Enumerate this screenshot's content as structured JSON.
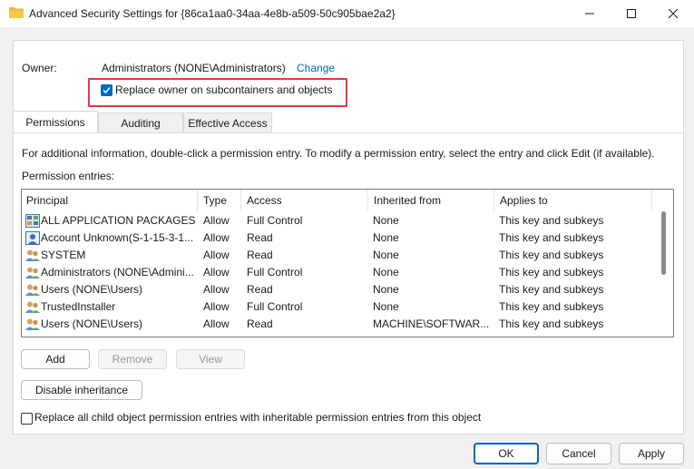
{
  "window": {
    "title": "Advanced Security Settings for {86ca1aa0-34aa-4e8b-a509-50c905bae2a2}"
  },
  "owner": {
    "label": "Owner:",
    "value": "Administrators (NONE\\Administrators)",
    "change_link": "Change",
    "replace_checkbox_label": "Replace owner on subcontainers and objects",
    "replace_checked": true
  },
  "tabs": [
    {
      "label": "Permissions",
      "active": true
    },
    {
      "label": "Auditing",
      "active": false
    },
    {
      "label": "Effective Access",
      "active": false
    }
  ],
  "permissions": {
    "info": "For additional information, double-click a permission entry. To modify a permission entry, select the entry and click Edit (if available).",
    "entries_label": "Permission entries:",
    "columns": [
      "Principal",
      "Type",
      "Access",
      "Inherited from",
      "Applies to"
    ],
    "rows": [
      {
        "icon": "app-packages-icon",
        "principal": "ALL APPLICATION PACKAGES",
        "type": "Allow",
        "access": "Full Control",
        "inherited": "None",
        "applies": "This key and subkeys"
      },
      {
        "icon": "account-icon",
        "principal": "Account Unknown(S-1-15-3-1...",
        "type": "Allow",
        "access": "Read",
        "inherited": "None",
        "applies": "This key and subkeys"
      },
      {
        "icon": "users-group-icon",
        "principal": "SYSTEM",
        "type": "Allow",
        "access": "Read",
        "inherited": "None",
        "applies": "This key and subkeys"
      },
      {
        "icon": "users-group-icon",
        "principal": "Administrators (NONE\\Admini...",
        "type": "Allow",
        "access": "Full Control",
        "inherited": "None",
        "applies": "This key and subkeys"
      },
      {
        "icon": "users-group-icon",
        "principal": "Users (NONE\\Users)",
        "type": "Allow",
        "access": "Read",
        "inherited": "None",
        "applies": "This key and subkeys"
      },
      {
        "icon": "users-group-icon",
        "principal": "TrustedInstaller",
        "type": "Allow",
        "access": "Full Control",
        "inherited": "None",
        "applies": "This key and subkeys"
      },
      {
        "icon": "users-group-icon",
        "principal": "Users (NONE\\Users)",
        "type": "Allow",
        "access": "Read",
        "inherited": "MACHINE\\SOFTWAR...",
        "applies": "This key and subkeys"
      }
    ]
  },
  "buttons": {
    "add": "Add",
    "remove": "Remove",
    "view": "View",
    "disable_inheritance": "Disable inheritance",
    "ok": "OK",
    "cancel": "Cancel",
    "apply": "Apply"
  },
  "replace_child": {
    "label": "Replace all child object permission entries with inheritable permission entries from this object",
    "checked": false
  },
  "colors": {
    "accent": "#0067c0",
    "highlight": "#e6393f"
  }
}
